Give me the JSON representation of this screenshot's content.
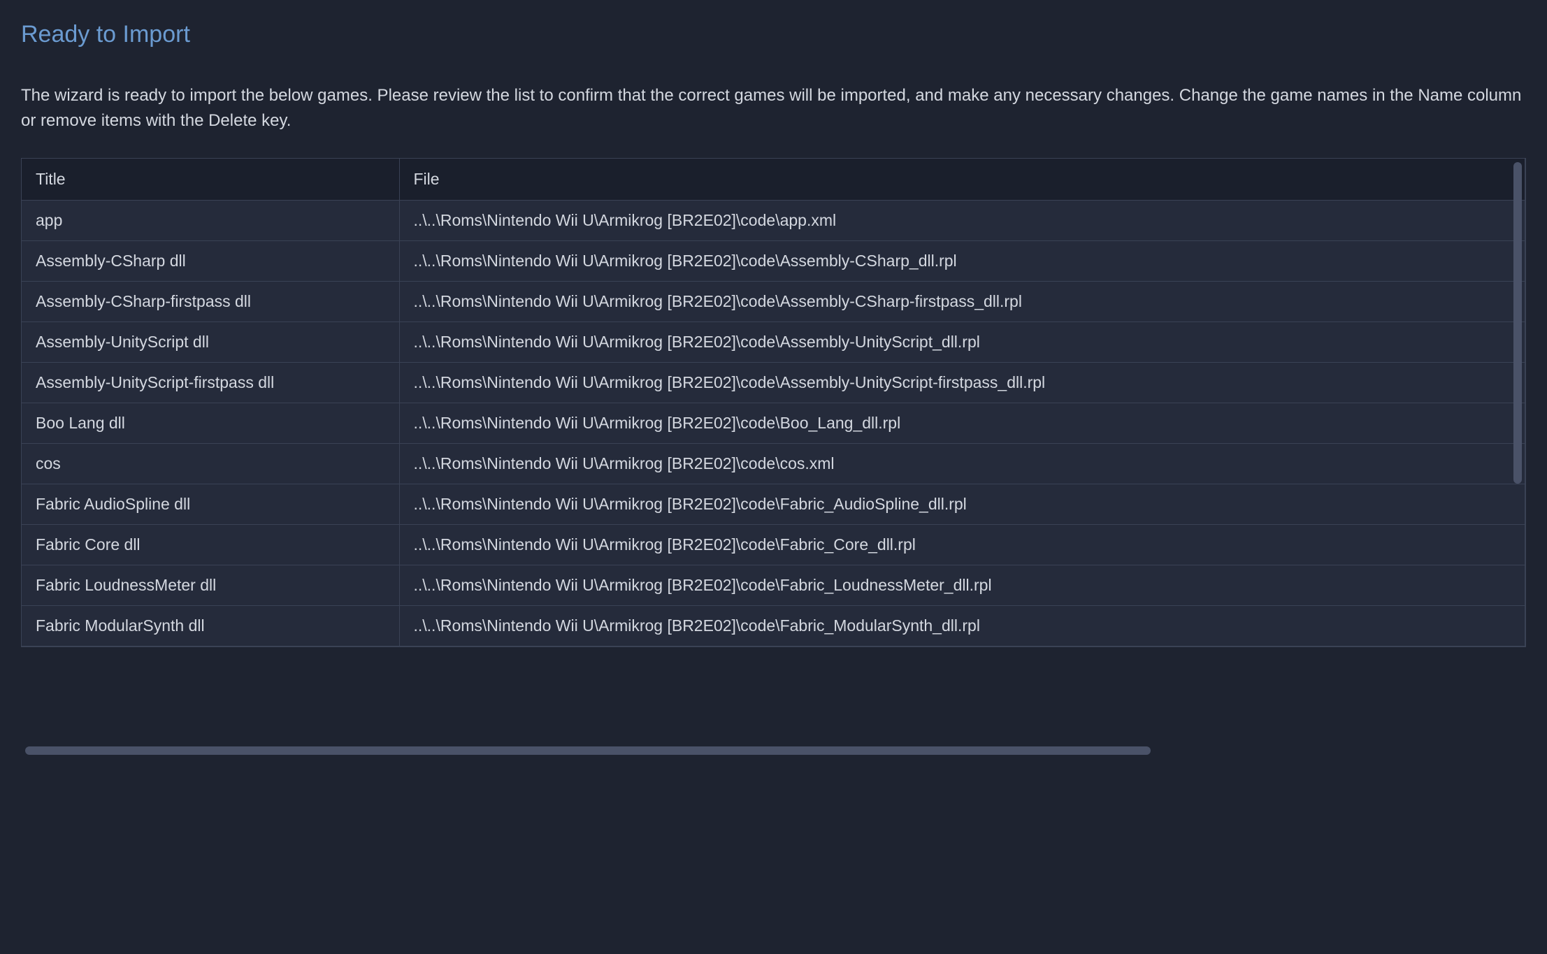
{
  "heading": "Ready to Import",
  "description": "The wizard is ready to import the below games. Please review the list to confirm that the correct games will be imported, and make any necessary changes. Change the game names in the Name column or remove items with the Delete key.",
  "table": {
    "columns": {
      "title": "Title",
      "file": "File"
    },
    "rows": [
      {
        "title": "app",
        "file": "..\\..\\Roms\\Nintendo Wii U\\Armikrog [BR2E02]\\code\\app.xml"
      },
      {
        "title": "Assembly-CSharp dll",
        "file": "..\\..\\Roms\\Nintendo Wii U\\Armikrog [BR2E02]\\code\\Assembly-CSharp_dll.rpl"
      },
      {
        "title": "Assembly-CSharp-firstpass dll",
        "file": "..\\..\\Roms\\Nintendo Wii U\\Armikrog [BR2E02]\\code\\Assembly-CSharp-firstpass_dll.rpl"
      },
      {
        "title": "Assembly-UnityScript dll",
        "file": "..\\..\\Roms\\Nintendo Wii U\\Armikrog [BR2E02]\\code\\Assembly-UnityScript_dll.rpl"
      },
      {
        "title": "Assembly-UnityScript-firstpass dll",
        "file": "..\\..\\Roms\\Nintendo Wii U\\Armikrog [BR2E02]\\code\\Assembly-UnityScript-firstpass_dll.rpl"
      },
      {
        "title": "Boo Lang dll",
        "file": "..\\..\\Roms\\Nintendo Wii U\\Armikrog [BR2E02]\\code\\Boo_Lang_dll.rpl"
      },
      {
        "title": "cos",
        "file": "..\\..\\Roms\\Nintendo Wii U\\Armikrog [BR2E02]\\code\\cos.xml"
      },
      {
        "title": "Fabric AudioSpline dll",
        "file": "..\\..\\Roms\\Nintendo Wii U\\Armikrog [BR2E02]\\code\\Fabric_AudioSpline_dll.rpl"
      },
      {
        "title": "Fabric Core dll",
        "file": "..\\..\\Roms\\Nintendo Wii U\\Armikrog [BR2E02]\\code\\Fabric_Core_dll.rpl"
      },
      {
        "title": "Fabric LoudnessMeter dll",
        "file": "..\\..\\Roms\\Nintendo Wii U\\Armikrog [BR2E02]\\code\\Fabric_LoudnessMeter_dll.rpl"
      },
      {
        "title": "Fabric ModularSynth dll",
        "file": "..\\..\\Roms\\Nintendo Wii U\\Armikrog [BR2E02]\\code\\Fabric_ModularSynth_dll.rpl"
      }
    ]
  }
}
